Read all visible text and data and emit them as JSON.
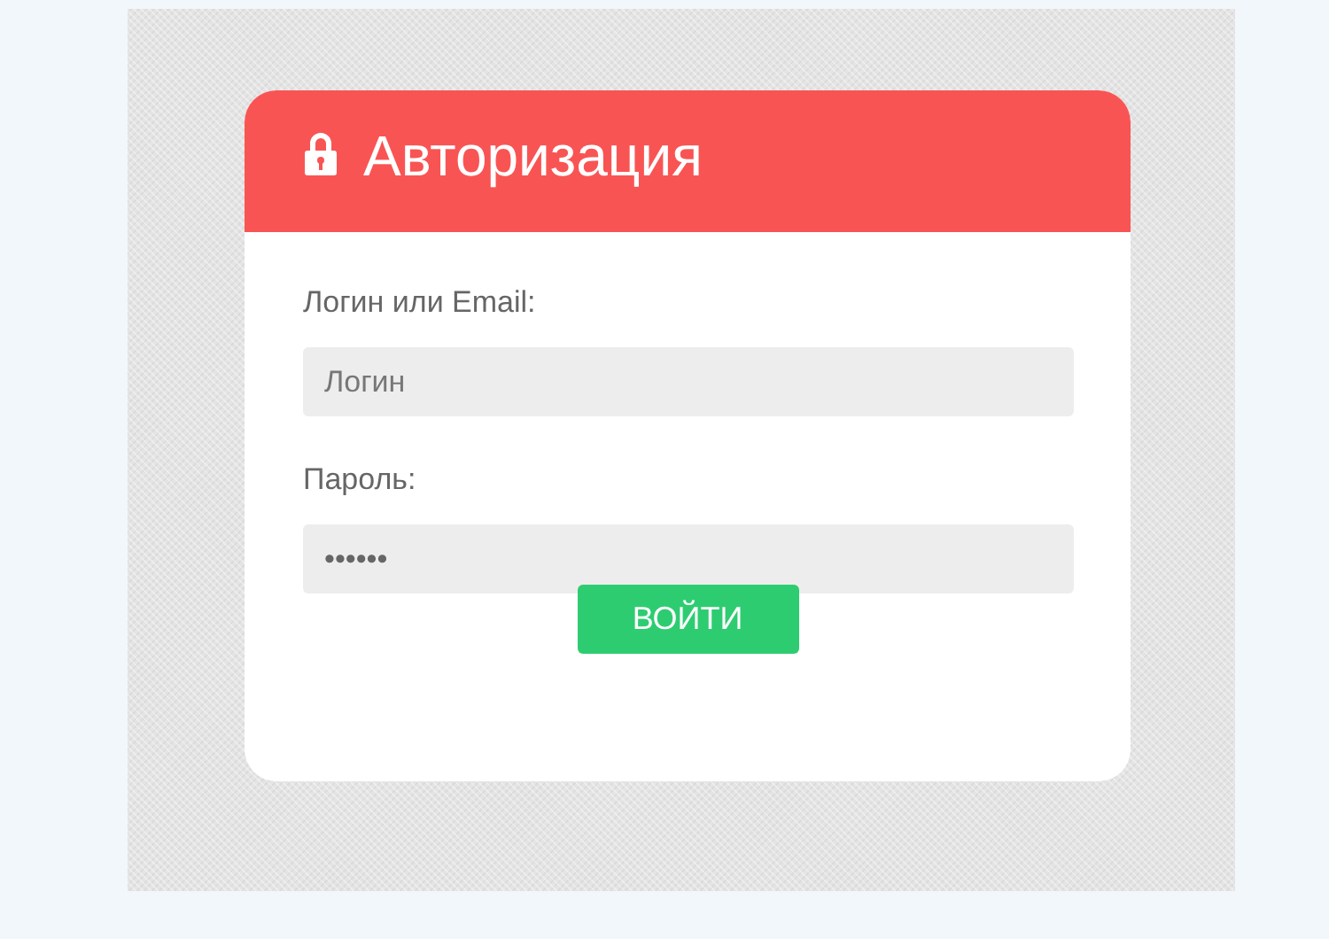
{
  "dialog": {
    "title": "Авторизация",
    "fields": [
      {
        "label": "Логин или Email:",
        "placeholder": "Логин"
      },
      {
        "label": "Пароль:",
        "value": "••••••"
      }
    ],
    "submit": "ВОЙТИ"
  }
}
